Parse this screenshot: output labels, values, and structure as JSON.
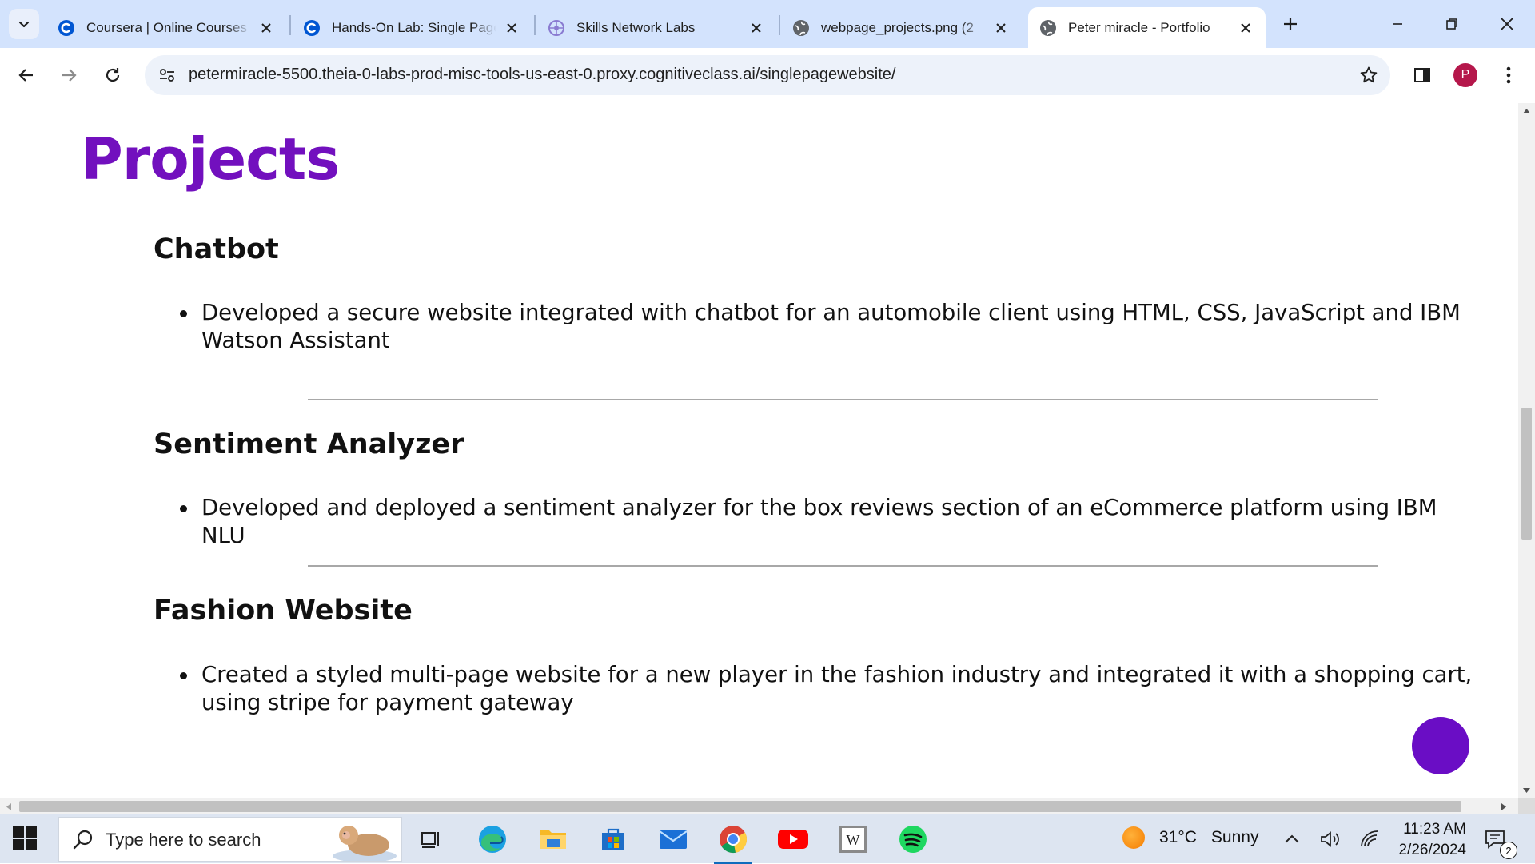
{
  "browser": {
    "tabs": [
      {
        "title": "Coursera | Online Courses & Credentials",
        "favicon": "coursera-icon",
        "active": false
      },
      {
        "title": "Hands-On Lab: Single Page Website",
        "favicon": "coursera-icon",
        "active": false
      },
      {
        "title": "Skills Network Labs",
        "favicon": "skills-network-icon",
        "active": false
      },
      {
        "title": "webpage_projects.png (2",
        "favicon": "globe-icon",
        "active": false
      },
      {
        "title": "Peter miracle - Portfolio",
        "favicon": "globe-icon",
        "active": true
      }
    ],
    "url": "petermiracle-5500.theia-0-labs-prod-misc-tools-us-east-0.proxy.cognitiveclass.ai/singlepagewebsite/",
    "profile_initial": "P",
    "profile_color": "#b5174b",
    "tabstrip_color": "#d3e3fd"
  },
  "page": {
    "heading": "Projects",
    "heading_color": "#7210be",
    "fab_color": "#6a0dc5",
    "projects": [
      {
        "title": "Chatbot",
        "desc": "Developed a secure website integrated with chatbot for an automobile client using HTML, CSS, JavaScript and IBM Watson Assistant"
      },
      {
        "title": "Sentiment Analyzer",
        "desc": "Developed and deployed a sentiment analyzer for the box reviews section of an eCommerce platform using IBM NLU"
      },
      {
        "title": "Fashion Website",
        "desc": "Created a styled multi-page website for a new player in the fashion industry and integrated it with a shopping cart, using stripe for payment gateway"
      }
    ]
  },
  "taskbar": {
    "search_placeholder": "Type here to search",
    "pinned_apps": [
      "task-view-icon",
      "edge-icon",
      "file-explorer-icon",
      "microsoft-store-icon",
      "mail-icon",
      "chrome-icon",
      "youtube-icon",
      "wikipedia-icon",
      "spotify-icon"
    ],
    "running_app": "chrome-icon",
    "weather": {
      "temp": "31°C",
      "condition": "Sunny"
    },
    "time": "11:23 AM",
    "date": "2/26/2024",
    "notification_count": "2"
  }
}
